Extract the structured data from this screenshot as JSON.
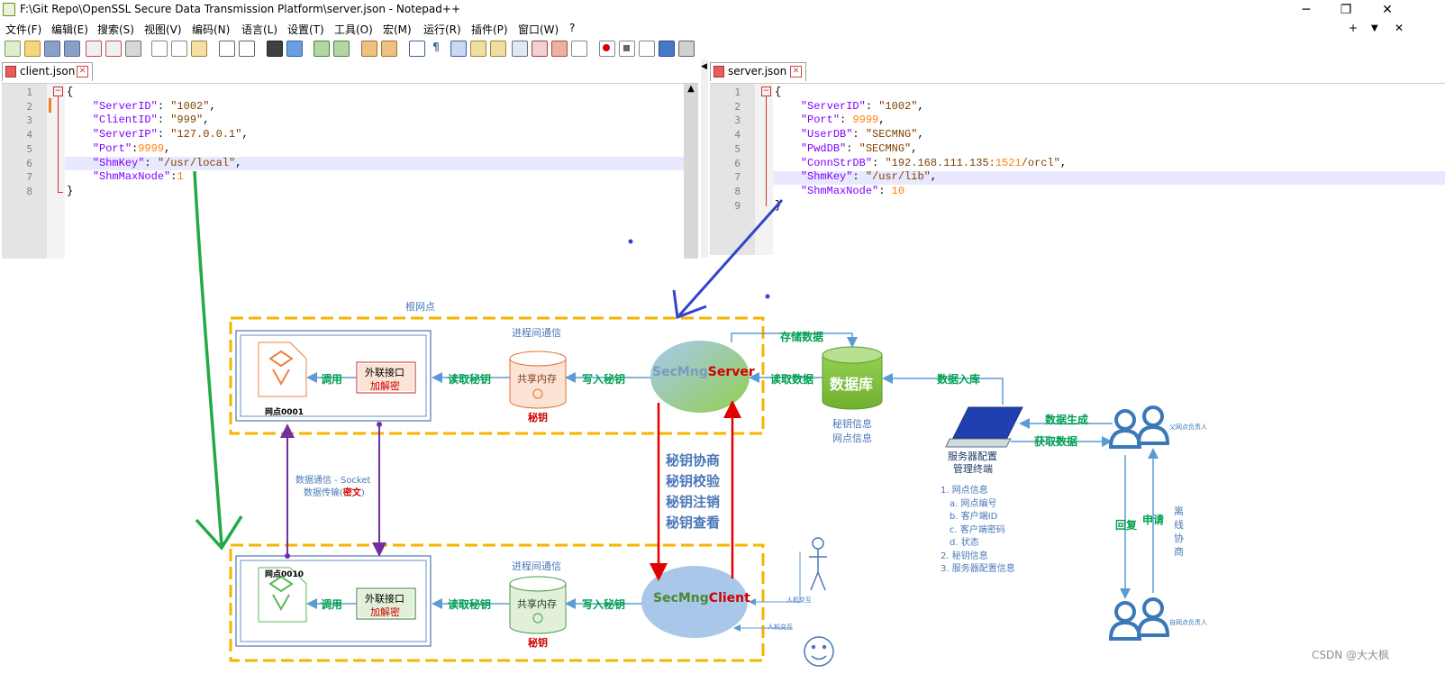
{
  "window": {
    "title": "F:\\Git Repo\\OpenSSL Secure Data Transmission Platform\\server.json - Notepad++",
    "minimize": "─",
    "restore": "❐",
    "close": "✕"
  },
  "menu": [
    "文件(F)",
    "编辑(E)",
    "搜索(S)",
    "视图(V)",
    "编码(N)",
    "语言(L)",
    "设置(T)",
    "工具(O)",
    "宏(M)",
    "运行(R)",
    "插件(P)",
    "窗口(W)",
    "?"
  ],
  "menu_right": {
    "plus": "+",
    "down": "▼",
    "close": "✕"
  },
  "left_editor": {
    "tab": "client.json",
    "line_numbers": [
      "1",
      "2",
      "3",
      "4",
      "5",
      "6",
      "7",
      "8"
    ],
    "lines": [
      "{",
      "    \"ServerID\": \"1002\",",
      "    \"ClientID\": \"999\",",
      "    \"ServerIP\": \"127.0.0.1\",",
      "    \"Port\":9999,",
      "    \"ShmKey\": \"/usr/local\",",
      "    \"ShmMaxNode\":1",
      "}"
    ]
  },
  "right_editor": {
    "tab": "server.json",
    "line_numbers": [
      "1",
      "2",
      "3",
      "4",
      "5",
      "6",
      "7",
      "8",
      "9"
    ],
    "lines": [
      "{",
      "    \"ServerID\": \"1002\",",
      "    \"Port\": 9999,",
      "    \"UserDB\": \"SECMNG\",",
      "    \"PwdDB\": \"SECMNG\",",
      "    \"ConnStrDB\": \"192.168.111.135:1521/orcl\",",
      "    \"ShmKey\": \"/usr/lib\",",
      "    \"ShmMaxNode\": 10",
      "}"
    ]
  },
  "diagram": {
    "root_label": "根网点",
    "ipc_top": "进程间通信",
    "ipc_bottom": "进程间通信",
    "node_top": "网点0001",
    "node_bottom": "网点0010",
    "call": "调用",
    "ext_iface": "外联接口",
    "encdec": "加解密",
    "read_key": "读取秘钥",
    "write_key": "写入秘钥",
    "shm": "共享内存",
    "key": "秘钥",
    "server_a": "SecMng",
    "server_b": "Server",
    "client_a": "SecMng",
    "client_b": "Client",
    "store_data": "存储数据",
    "read_data": "读取数据",
    "db": "数据库",
    "db_info1": "秘钥信息",
    "db_info2": "网点信息",
    "data_in": "数据入库",
    "data_gen": "数据生成",
    "get_data": "获取数据",
    "terminal1": "服务器配置",
    "terminal2": "管理终端",
    "parent_person": "父网点负责人",
    "child_person": "自网点负责人",
    "reply": "回复",
    "apply": "申请",
    "offline": [
      "离",
      "线",
      "协",
      "商"
    ],
    "hci": "人机交互",
    "socket1": "数据通信 - Socket",
    "socket2a": "数据传输(",
    "socket2b": "密文",
    "socket2c": ")",
    "ops": [
      "秘钥协商",
      "秘钥校验",
      "秘钥注销",
      "秘钥查看"
    ],
    "info": [
      "1. 网点信息",
      "a. 网点编号",
      "b. 客户端ID",
      "c. 客户端密码",
      "d. 状态",
      "2. 秘钥信息",
      "3. 服务器配置信息"
    ],
    "watermark": "CSDN @大大枫"
  }
}
